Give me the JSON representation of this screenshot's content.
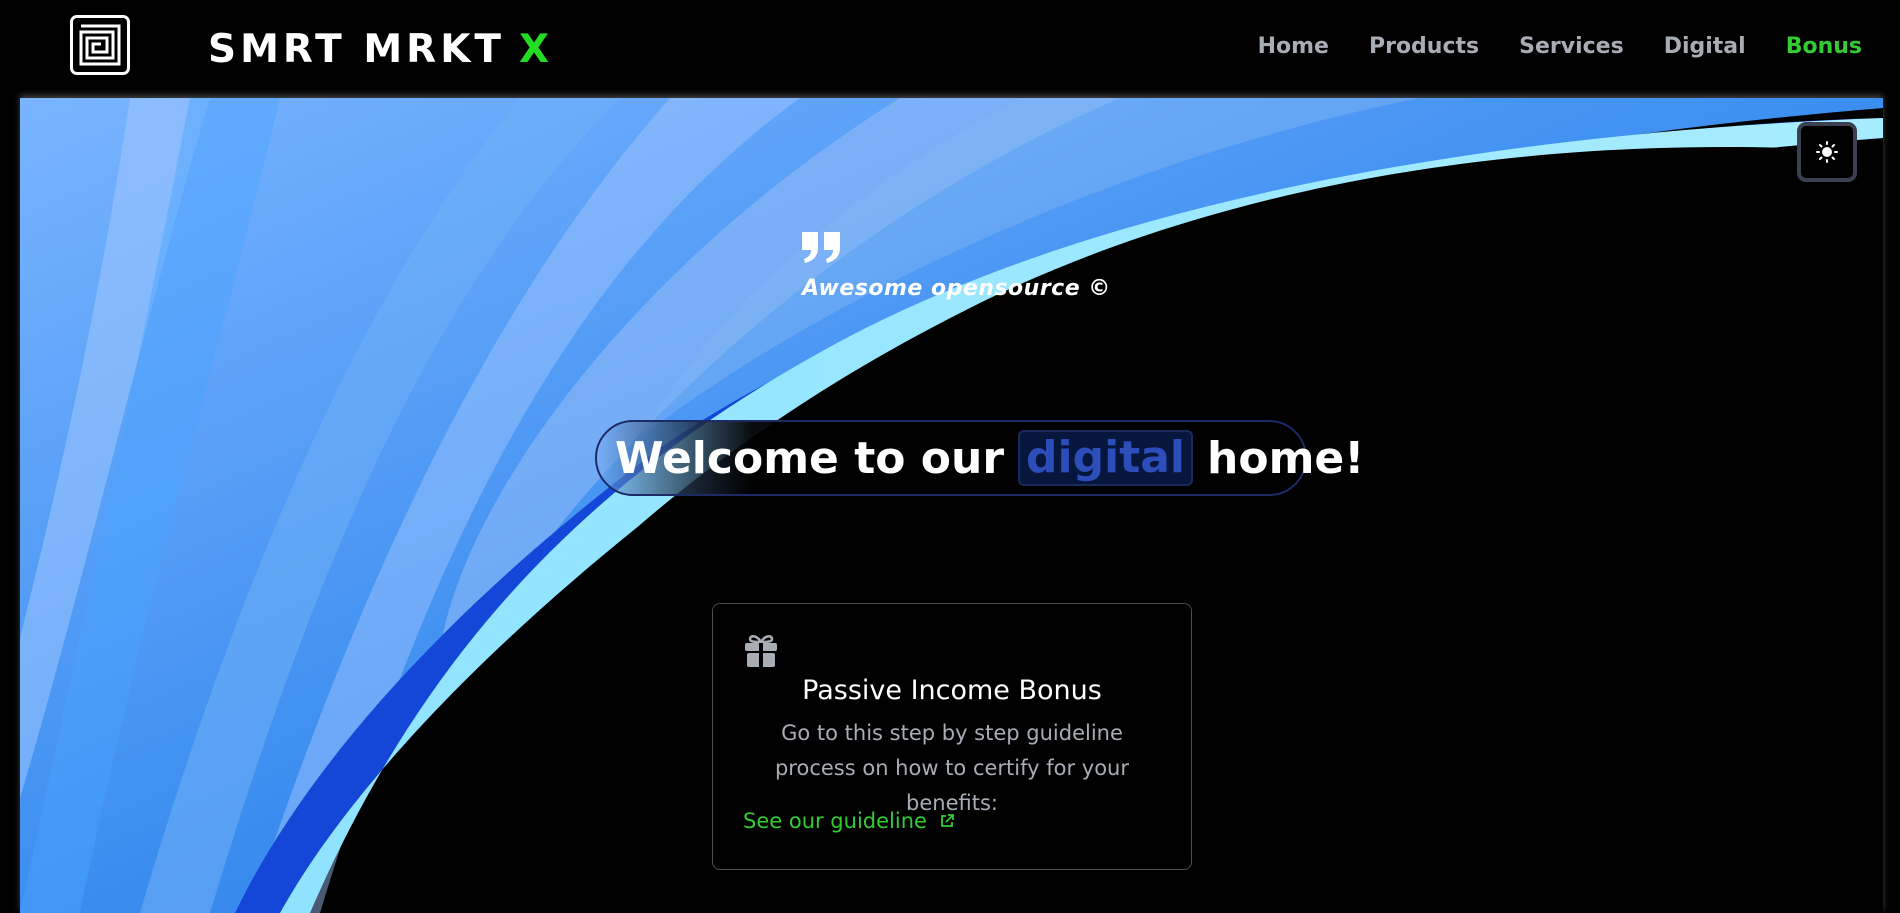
{
  "brand": {
    "name": "SMRT MRKT",
    "suffix": "X"
  },
  "nav": {
    "items": [
      {
        "label": "Home"
      },
      {
        "label": "Products"
      },
      {
        "label": "Services"
      },
      {
        "label": "Digital"
      },
      {
        "label": "Bonus",
        "active": true
      }
    ]
  },
  "hero": {
    "quote": "Awesome opensource ©",
    "welcome": {
      "before": "Welcome to our",
      "highlight": "digital",
      "after": "home!"
    }
  },
  "card": {
    "title": "Passive Income Bonus",
    "description": "Go to this step by step guideline process on how to certify for your benefits:",
    "link_label": "See our guideline"
  },
  "icons": {
    "logo": "maze-logo-icon",
    "theme": "sun-icon",
    "quote": "quote-icon",
    "gift": "gift-icon",
    "external": "external-link-icon"
  },
  "colors": {
    "accent_green": "#33cc33",
    "brand_x": "#22dd22",
    "nav_text": "#a8acb4",
    "highlight_text": "#2d4dbb",
    "background": "#000000"
  }
}
